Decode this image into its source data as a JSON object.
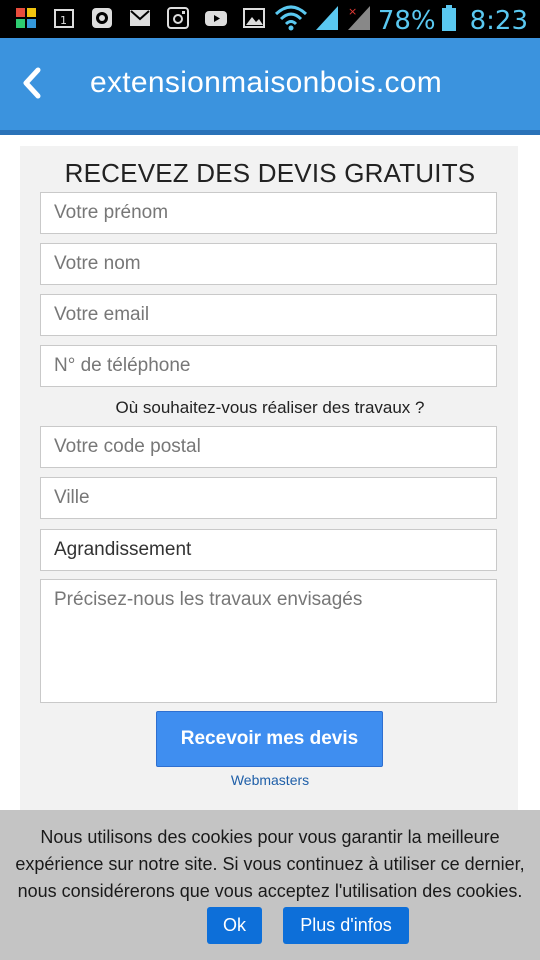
{
  "status_bar": {
    "battery": "78%",
    "time": "8:23",
    "icons": [
      "app-icon",
      "calendar-icon",
      "circle-icon",
      "gmail-icon",
      "instagram-icon",
      "youtube-icon",
      "gallery-icon",
      "wifi-icon",
      "signal-icon",
      "signal-icon",
      "battery-icon"
    ],
    "accent": "#5ac8f0"
  },
  "app_bar": {
    "title": "extensionmaisonbois.com",
    "back_icon": "back-arrow-icon",
    "color": "#3b93de"
  },
  "form": {
    "heading": "RECEVEZ DES DEVIS GRATUITS",
    "first_name_placeholder": "Votre prénom",
    "last_name_placeholder": "Votre nom",
    "email_placeholder": "Votre email",
    "phone_placeholder": "N° de téléphone",
    "location_question": "Où souhaitez-vous réaliser des travaux ?",
    "postal_code_placeholder": "Votre code postal",
    "city_placeholder": "Ville",
    "work_type_selected": "Agrandissement",
    "details_placeholder": "Précisez-nous les travaux envisagés",
    "submit_label": "Recevoir mes devis",
    "webmasters_link": "Webmasters"
  },
  "cookie_banner": {
    "text": "Nous utilisons des cookies pour vous garantir la meilleure expérience sur notre site. Si vous continuez à utiliser ce dernier, nous considérerons que vous acceptez l'utilisation des cookies.",
    "ok_label": "Ok",
    "more_label": "Plus d'infos"
  }
}
